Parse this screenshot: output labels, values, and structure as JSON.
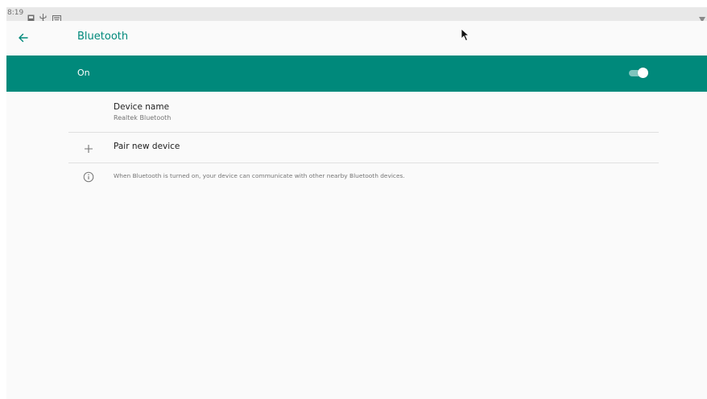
{
  "status_bar": {
    "time": "8:19",
    "icons": [
      "notification-box-icon",
      "usb-icon",
      "keyboard-icon",
      "wifi-icon"
    ]
  },
  "app_bar": {
    "back_icon": "arrow-back-icon",
    "title": "Bluetooth"
  },
  "main_switch": {
    "label": "On",
    "state": "on"
  },
  "list": {
    "device_name": {
      "title": "Device name",
      "value": "Realtek Bluetooth"
    },
    "pair_new_device": {
      "icon": "plus-icon",
      "label": "Pair new device"
    },
    "info": {
      "icon": "info-icon",
      "text": "When Bluetooth is turned on, your device can communicate with other nearby Bluetooth devices."
    }
  },
  "colors": {
    "accent": "#00897b",
    "background": "#fafafa",
    "status_bar": "#e8e8e8",
    "divider": "#e0e0e0",
    "primary_text": "#212121",
    "secondary_text": "#757575"
  }
}
